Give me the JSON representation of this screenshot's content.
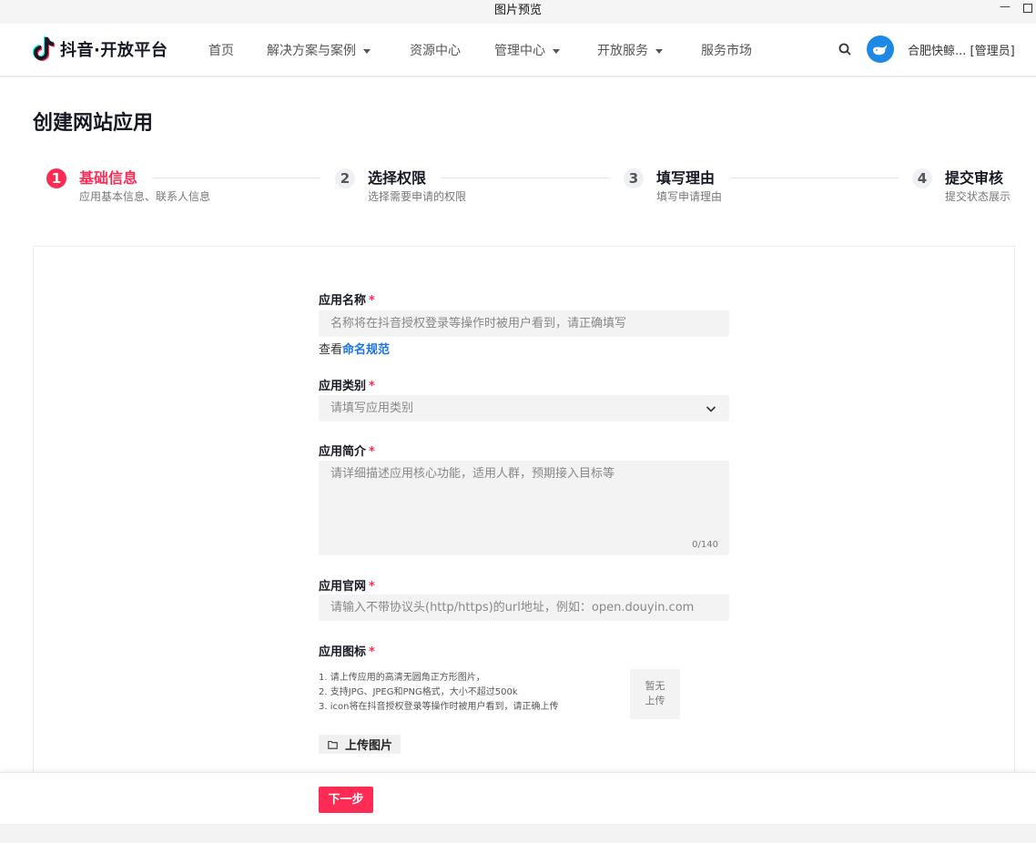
{
  "window": {
    "title": "图片预览",
    "minimize": "—"
  },
  "nav": {
    "brand": "抖音·开放平台",
    "items": [
      {
        "label": "首页",
        "dropdown": false
      },
      {
        "label": "解决方案与案例",
        "dropdown": true
      },
      {
        "label": "资源中心",
        "dropdown": false
      },
      {
        "label": "管理中心",
        "dropdown": true
      },
      {
        "label": "开放服务",
        "dropdown": true
      },
      {
        "label": "服务市场",
        "dropdown": false
      }
    ],
    "user": "合肥快鲸... [管理员]"
  },
  "page": {
    "title": "创建网站应用"
  },
  "steps": [
    {
      "num": "1",
      "title": "基础信息",
      "sub": "应用基本信息、联系人信息",
      "active": true
    },
    {
      "num": "2",
      "title": "选择权限",
      "sub": "选择需要申请的权限",
      "active": false
    },
    {
      "num": "3",
      "title": "填写理由",
      "sub": "填写申请理由",
      "active": false
    },
    {
      "num": "4",
      "title": "提交审核",
      "sub": "提交状态展示",
      "active": false
    }
  ],
  "form": {
    "required_mark": "*",
    "name": {
      "label": "应用名称",
      "placeholder": "名称将在抖音授权登录等操作时被用户看到，请正确填写",
      "hint_prefix": "查看",
      "hint_link": "命名规范"
    },
    "category": {
      "label": "应用类别",
      "placeholder": "请填写应用类别"
    },
    "intro": {
      "label": "应用简介",
      "placeholder": "请详细描述应用核心功能，适用人群，预期接入目标等",
      "counter": "0/140"
    },
    "website": {
      "label": "应用官网",
      "placeholder": "请输入不带协议头(http/https)的url地址，例如：open.douyin.com"
    },
    "icon": {
      "label": "应用图标",
      "tips": [
        "1. 请上传应用的高清无圆角正方形图片，",
        "2. 支持JPG、JPEG和PNG格式，大小不超过500k",
        "3. icon将在抖音授权登录等操作时被用户看到，请正确上传"
      ],
      "preview_line1": "暂无",
      "preview_line2": "上传",
      "upload_label": "上传图片"
    }
  },
  "footer": {
    "next_label": "下一步"
  },
  "colors": {
    "accent": "#fe2c55",
    "link": "#1a73e8"
  }
}
